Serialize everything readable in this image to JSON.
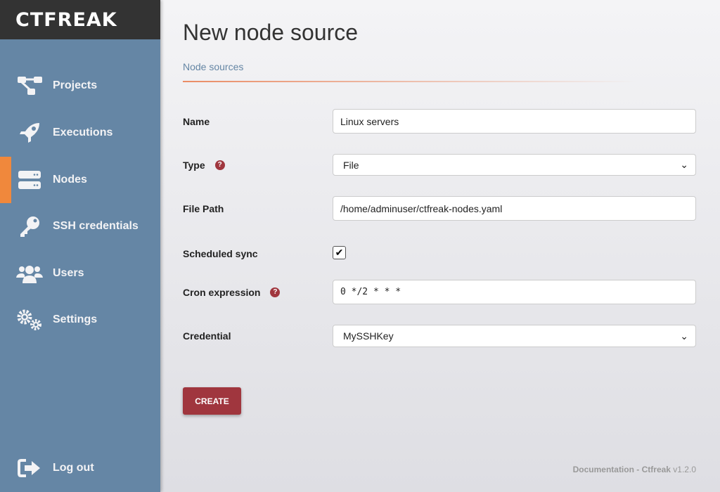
{
  "logo": "CTFREAK",
  "sidebar": {
    "items": [
      {
        "label": "Projects",
        "icon": "project-diagram-icon"
      },
      {
        "label": "Executions",
        "icon": "rocket-icon"
      },
      {
        "label": "Nodes",
        "icon": "server-icon",
        "active": true
      },
      {
        "label": "SSH credentials",
        "icon": "key-icon"
      },
      {
        "label": "Users",
        "icon": "users-icon"
      },
      {
        "label": "Settings",
        "icon": "cogs-icon"
      }
    ],
    "logout": "Log out"
  },
  "page": {
    "title": "New node source",
    "breadcrumb": "Node sources"
  },
  "form": {
    "name_label": "Name",
    "name_value": "Linux servers",
    "type_label": "Type",
    "type_value": "File",
    "path_label": "File Path",
    "path_value": "/home/adminuser/ctfreak-nodes.yaml",
    "sync_label": "Scheduled sync",
    "sync_checked": true,
    "cron_label": "Cron expression",
    "cron_value": "0 */2 * * *",
    "cred_label": "Credential",
    "cred_value": "MySSHKey",
    "help": "?",
    "create": "CREATE"
  },
  "footer": {
    "doc": "Documentation",
    "sep": " - ",
    "brand": "Ctfreak",
    "version": " v1.2.0"
  },
  "colors": {
    "sidebar": "#6586a5",
    "accent": "#f0883c",
    "button": "#a0363e"
  }
}
